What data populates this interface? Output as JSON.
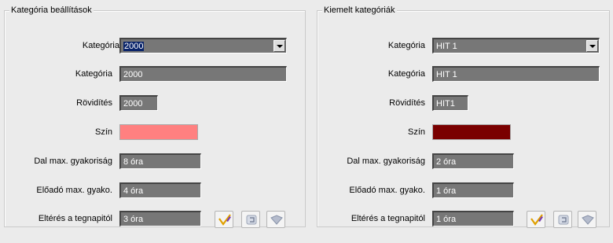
{
  "left_panel": {
    "title": "Kategória beállítások",
    "category_label": "Kategória",
    "category_selected": "2000",
    "name_label": "Kategória",
    "name_value": "2000",
    "abbrev_label": "Rövidítés",
    "abbrev_value": "2000",
    "color_label": "Szín",
    "color_value": "#ff8080",
    "song_freq_label": "Dal max. gyakoriság",
    "song_freq_value": "8 óra",
    "artist_freq_label": "Előadó max. gyako.",
    "artist_freq_value": "4 óra",
    "diff_label": "Eltérés a tegnapitól",
    "diff_value": "3 óra"
  },
  "right_panel": {
    "title": "Kiemelt kategóriák",
    "category_label": "Kategória",
    "category_selected": "HIT 1",
    "name_label": "Kategória",
    "name_value": "HIT 1",
    "abbrev_label": "Rövidítés",
    "abbrev_value": "HIT1",
    "color_label": "Szín",
    "color_value": "#7a0000",
    "song_freq_label": "Dal max. gyakoriság",
    "song_freq_value": "2 óra",
    "artist_freq_label": "Előadó max. gyako.",
    "artist_freq_value": "1 óra",
    "diff_label": "Eltérés a tegnapitól",
    "diff_value": "1 óra"
  },
  "icons": {
    "edit": "edit-pencil-icon",
    "cancel": "undo-icon",
    "save": "save-icon"
  }
}
